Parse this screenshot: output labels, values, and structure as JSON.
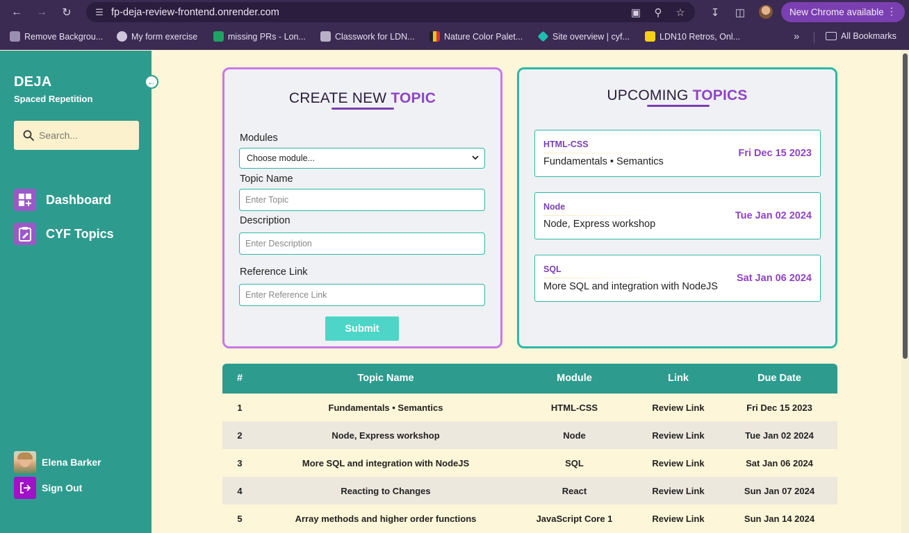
{
  "browser": {
    "url": "fp-deja-review-frontend.onrender.com",
    "new_chrome_label": "New Chrome available",
    "bookmarks": [
      {
        "label": "Remove Backgrou...",
        "icon": "stack-icon"
      },
      {
        "label": "My form exercise",
        "icon": "globe-icon"
      },
      {
        "label": "missing PRs - Lon...",
        "icon": "sheets-icon"
      },
      {
        "label": "Classwork for LDN...",
        "icon": "classroom-icon"
      },
      {
        "label": "Nature Color Palet...",
        "icon": "palette-icon"
      },
      {
        "label": "Site overview | cyf...",
        "icon": "diamond-icon"
      },
      {
        "label": "LDN10 Retros, Onl...",
        "icon": "miro-icon"
      }
    ],
    "all_bookmarks_label": "All Bookmarks"
  },
  "sidebar": {
    "brand": "DEJA",
    "subtitle": "Spaced Repetition",
    "search_placeholder": "Search...",
    "nav": [
      {
        "label": "Dashboard",
        "icon": "dashboard-icon"
      },
      {
        "label": "CYF Topics",
        "icon": "clipboard-icon"
      }
    ],
    "user_name": "Elena Barker",
    "sign_out_label": "Sign Out"
  },
  "create_form": {
    "title_prefix": "CREATE NEW ",
    "title_accent": "TOPIC",
    "modules_label": "Modules",
    "modules_selected": "Choose module...",
    "topic_name_label": "Topic Name",
    "topic_name_placeholder": "Enter Topic",
    "description_label": "Description",
    "description_placeholder": "Enter Description",
    "reference_label": "Reference Link",
    "reference_placeholder": "Enter Reference Link",
    "submit_label": "Submit"
  },
  "upcoming": {
    "title_prefix": "UPCOMING ",
    "title_accent": "TOPICS",
    "items": [
      {
        "module": "HTML-CSS",
        "topic": "Fundamentals • Semantics",
        "date": "Fri Dec 15 2023"
      },
      {
        "module": "Node",
        "topic": "Node, Express workshop",
        "date": "Tue Jan 02 2024"
      },
      {
        "module": "SQL",
        "topic": "More SQL and integration with NodeJS",
        "date": "Sat Jan 06 2024"
      }
    ]
  },
  "table": {
    "headers": {
      "num": "#",
      "topic": "Topic Name",
      "module": "Module",
      "link": "Link",
      "due": "Due Date"
    },
    "rows": [
      {
        "num": "1",
        "topic": "Fundamentals • Semantics",
        "module": "HTML-CSS",
        "link": "Review Link",
        "due": "Fri Dec 15 2023"
      },
      {
        "num": "2",
        "topic": "Node, Express workshop",
        "module": "Node",
        "link": "Review Link",
        "due": "Tue Jan 02 2024"
      },
      {
        "num": "3",
        "topic": "More SQL and integration with NodeJS",
        "module": "SQL",
        "link": "Review Link",
        "due": "Sat Jan 06 2024"
      },
      {
        "num": "4",
        "topic": "Reacting to Changes",
        "module": "React",
        "link": "Review Link",
        "due": "Sun Jan 07 2024"
      },
      {
        "num": "5",
        "topic": "Array methods and higher order functions",
        "module": "JavaScript Core 1",
        "link": "Review Link",
        "due": "Sun Jan 14 2024"
      }
    ]
  },
  "colors": {
    "sidebar": "#2e9b8f",
    "accent_purple": "#8e44c4",
    "teal": "#2bb8a8",
    "page_bg": "#fdf6d8"
  }
}
